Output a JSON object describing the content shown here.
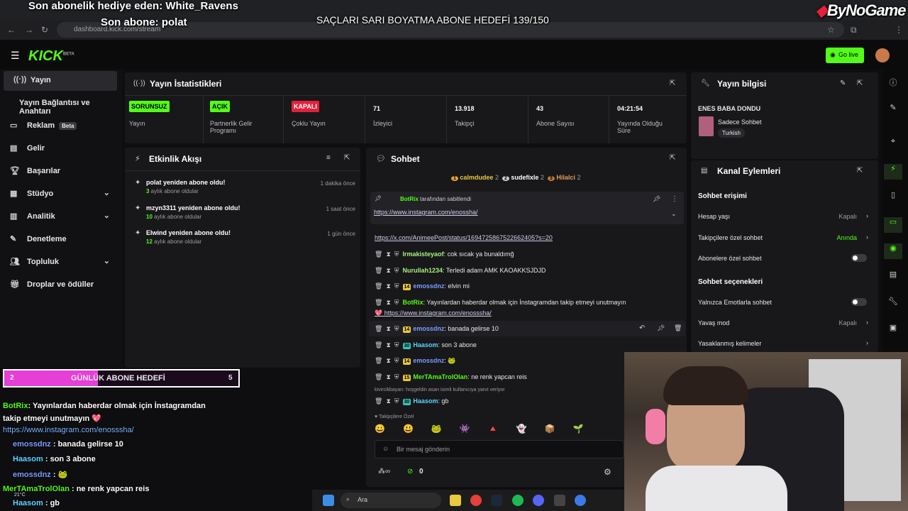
{
  "browser": {
    "url": "dashboard.kick.com/stream"
  },
  "overlay": {
    "last_gift": "Son abonelik hediye eden: White_Ravens",
    "last_sub": "Son abone: polat",
    "goal_banner": "SAÇLARI SARI BOYATMA ABONE HEDEFİ 139/150",
    "brand": "ByNoGame",
    "daily_goal": {
      "left": "2",
      "label": "GÜNLÜK ABONE HEDEFİ",
      "right": "5",
      "progress": 0.4
    },
    "chat": [
      {
        "user": "BotRix",
        "msg": ": Yayınlardan haberdar olmak için İnstagramdan"
      },
      {
        "user": "",
        "msg": "takip etmeyi unutmayın 💖"
      },
      {
        "user": "",
        "msg": "https://www.instagram.com/enosssha/"
      },
      {
        "user": "emossdnz",
        "msg": " : banada gelirse 10"
      },
      {
        "user": "Haasom",
        "msg": " : son 3 abone"
      },
      {
        "user": "emossdnz",
        "msg": " : 🐸"
      },
      {
        "user": "MerTAmaTrolOlan",
        "msg": " : ne renk yapcan reis"
      },
      {
        "user": "Haasom",
        "msg": " : gb"
      }
    ],
    "weather": "21°C"
  },
  "kick": {
    "logo": "KICK",
    "logo_sup": "BETA",
    "go_live": "Go live"
  },
  "sidebar": {
    "items": [
      {
        "label": "Yayın"
      },
      {
        "label": "Yayın Bağlantısı ve Anahtarı"
      },
      {
        "label": "Reklam",
        "badge": "Beta"
      },
      {
        "label": "Gelir"
      },
      {
        "label": "Başarılar"
      },
      {
        "label": "Stüdyo"
      },
      {
        "label": "Analitik"
      },
      {
        "label": "Denetleme"
      },
      {
        "label": "Topluluk"
      },
      {
        "label": "Droplar ve ödüller"
      }
    ]
  },
  "stats": {
    "title": "Yayın İstatistikleri",
    "items": [
      {
        "value": "SORUNSUZ",
        "label": "Yayın"
      },
      {
        "value": "AÇIK",
        "label": "Partnerlik Gelir Programı"
      },
      {
        "value": "KAPALI",
        "label": "Çoklu Yayın"
      },
      {
        "value": "71",
        "label": "İzleyici"
      },
      {
        "value": "13.918",
        "label": "Takipçi"
      },
      {
        "value": "43",
        "label": "Abone Sayısı"
      },
      {
        "value": "04:21:54",
        "label": "Yayında Olduğu Süre"
      }
    ]
  },
  "activity": {
    "title": "Etkinlik Akışı",
    "items": [
      {
        "text": "polat yeniden abone oldu!",
        "months": "3",
        "sub": " aylık abone oldular",
        "time": "1 dakika önce"
      },
      {
        "text": "mzyn3311 yeniden abone oldu!",
        "months": "10",
        "sub": " aylık abone oldular",
        "time": "1 saat önce"
      },
      {
        "text": "Elwind yeniden abone oldu!",
        "months": "12",
        "sub": " aylık abone oldular",
        "time": "1 gün önce"
      }
    ]
  },
  "chat": {
    "title": "Sohbet",
    "top_gifters": [
      {
        "rank": "1",
        "name": "calmdudee",
        "count": "2"
      },
      {
        "rank": "2",
        "name": "sudefixle",
        "count": "2"
      },
      {
        "rank": "3",
        "name": "Hilalci",
        "count": "2"
      }
    ],
    "pinned": {
      "by": "BotRix",
      "note": " tarafından sabitlendi",
      "link": "https://www.instagram.com/enossha/"
    },
    "messages": [
      {
        "sub": "",
        "user": "",
        "msg": "https://x.com/AnimeePost/status/1694725867522662405?s=20",
        "link": true
      },
      {
        "sub": "",
        "user": "Irmakisteyaof",
        "color": "#a8f07a",
        "msg": ": cok sıcak ya bunaldımğ"
      },
      {
        "sub": "",
        "user": "Nurullah1234",
        "color": "#a8f07a",
        "msg": ": Terledi adam AMK KAOAKKSJDJD"
      },
      {
        "sub": "14",
        "user": "emossdnz",
        "color": "#7a9cff",
        "msg": ": elvin mi"
      },
      {
        "sub": "",
        "user": "BotRix",
        "color": "#53fc18",
        "msg": ": Yayınlardan haberdar olmak için İnstagramdan takip etmeyi unutmayın"
      },
      {
        "sub": "",
        "user": "",
        "msg": "💖 https://www.instagram.com/enosssha/",
        "link": true
      },
      {
        "sub": "14",
        "user": "emossdnz",
        "color": "#7a9cff",
        "msg": ": banada gelirse 10"
      },
      {
        "sub": "30",
        "user": "Haasom",
        "color": "#5fd3ff",
        "msg": ": son 3 abone"
      },
      {
        "sub": "14",
        "user": "emossdnz",
        "color": "#7a9cff",
        "msg": ": 🐸"
      },
      {
        "sub": "15",
        "user": "MerTAmaTrolOlan",
        "color": "#53fc18",
        "msg": ": ne renk yapcan reis"
      },
      {
        "sub": "30",
        "user": "Haasom",
        "color": "#5fd3ff",
        "msg": ": gb"
      }
    ],
    "reply_note": "kivircikbayan: hoşgeldin asan isimli kullanıcıya yanıt veriyor",
    "followers_only": "Takipçilere Özel",
    "placeholder": "Bir mesaj gönderin",
    "points": "0"
  },
  "stream_info": {
    "title": "Yayın bilgisi",
    "stream_title": "ENES BABA DONDU",
    "category": "Sadece Sohbet",
    "language": "Turkish"
  },
  "channel": {
    "title": "Kanal Eylemleri",
    "chat_access": "Sohbet erişimi",
    "rows1": [
      {
        "label": "Hesap yaşı",
        "value": "Kapalı"
      },
      {
        "label": "Takipçilere özel sohbet",
        "value": "Anında"
      },
      {
        "label": "Abonelere özel sohbet",
        "value": ""
      }
    ],
    "chat_options": "Sohbet seçenekleri",
    "rows2": [
      {
        "label": "Yalnızca Emotlarla sohbet",
        "value": ""
      },
      {
        "label": "Yavaş mod",
        "value": "Kapalı"
      },
      {
        "label": "Yasaklanmış kelimeler",
        "value": ""
      }
    ]
  },
  "taskbar": {
    "search": "Ara"
  },
  "colors": {
    "accent": "#53fc18",
    "bg": "#0e0e10",
    "panel": "#18181b",
    "overlay_bar": "#e53fd6"
  }
}
